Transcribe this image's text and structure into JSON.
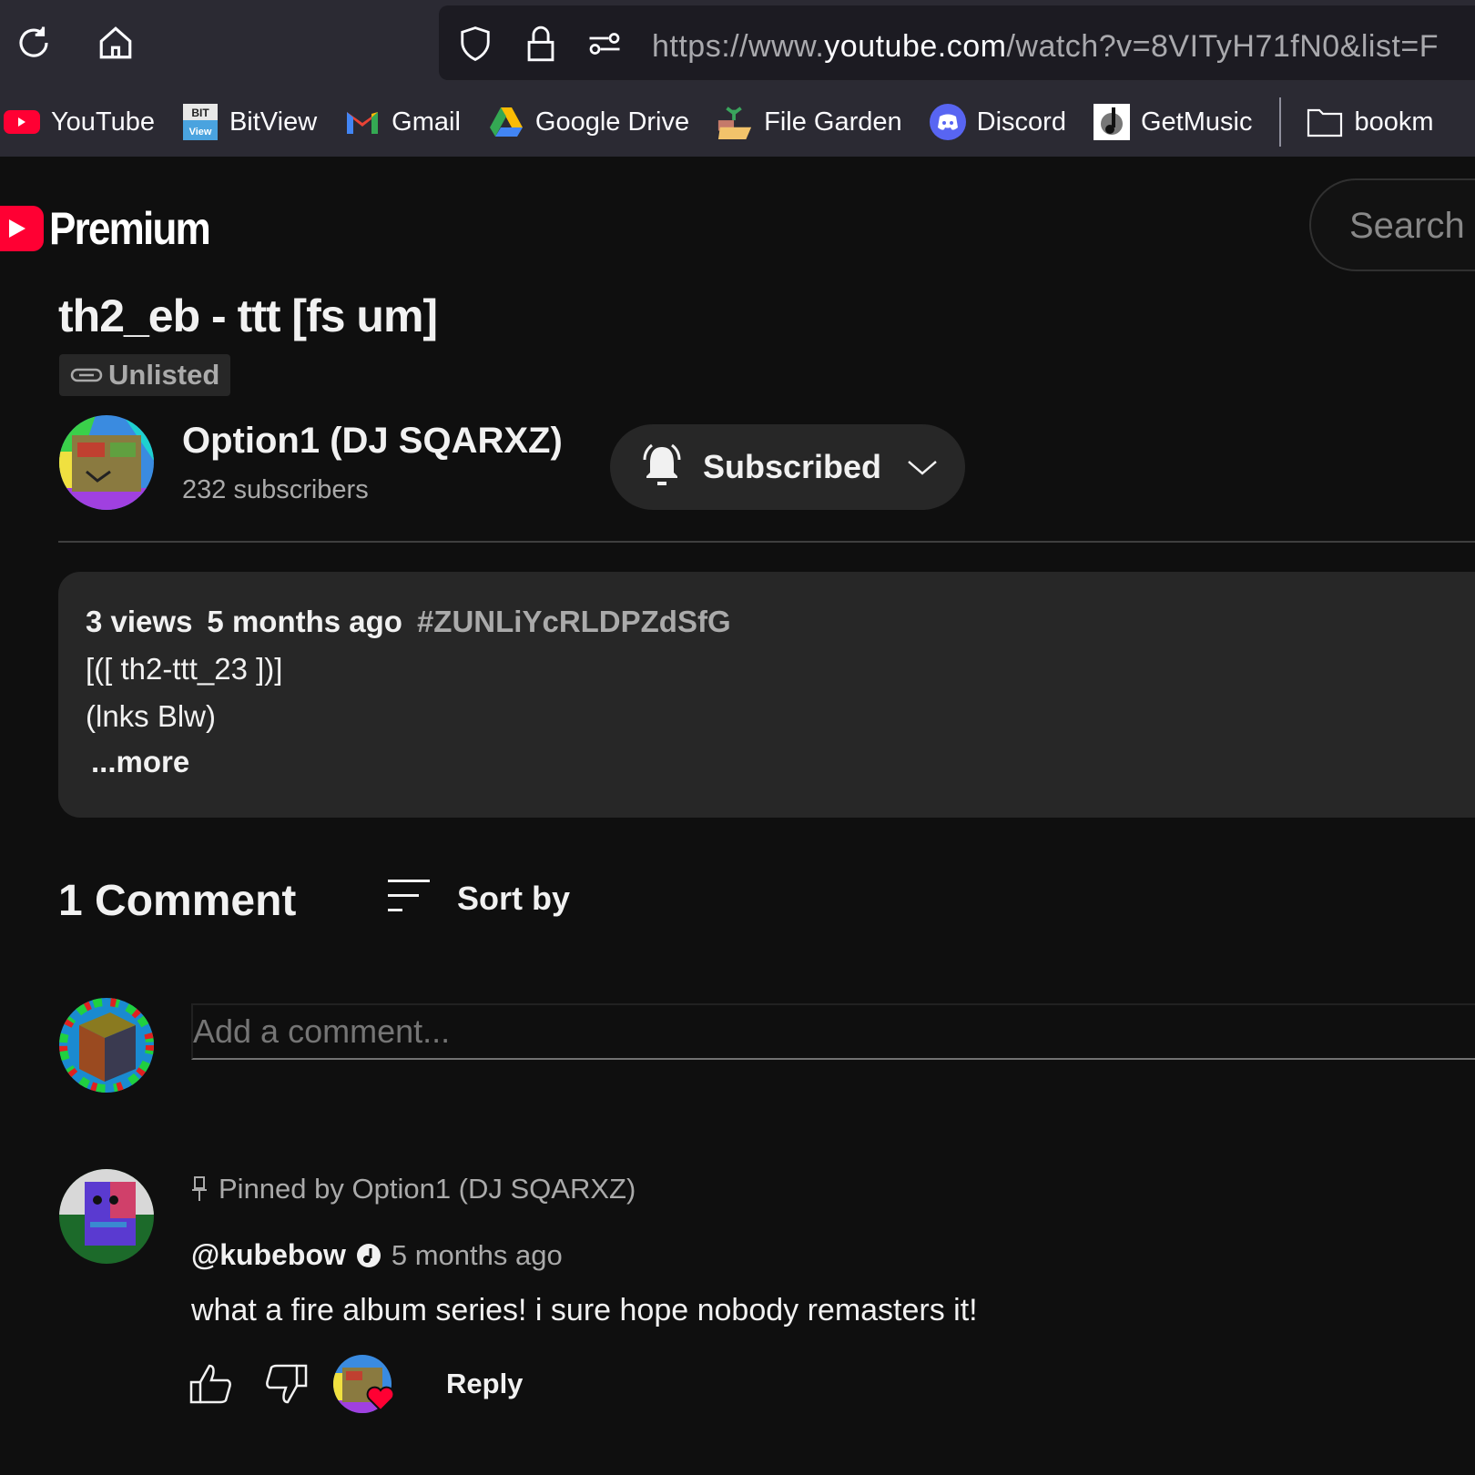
{
  "browser": {
    "url_prefix": "https://www.",
    "url_domain": "youtube.com",
    "url_rest": "/watch?v=8VITyH71fN0&list=F",
    "bookmarks": [
      {
        "label": "YouTube",
        "icon": "youtube-icon"
      },
      {
        "label": "BitView",
        "icon": "bitview-icon"
      },
      {
        "label": "Gmail",
        "icon": "gmail-icon"
      },
      {
        "label": "Google Drive",
        "icon": "google-drive-icon"
      },
      {
        "label": "File Garden",
        "icon": "file-garden-icon"
      },
      {
        "label": "Discord",
        "icon": "discord-icon"
      },
      {
        "label": "GetMusic",
        "icon": "getmusic-icon"
      },
      {
        "label": "bookm",
        "icon": "folder-icon"
      }
    ]
  },
  "youtube": {
    "logo_text": "Premium",
    "search_placeholder": "Search",
    "video": {
      "title": "th2_eb - ttt [fs um]",
      "visibility": "Unlisted",
      "channel_name": "Option1 (DJ SQARXZ)",
      "subscribers": "232 subscribers",
      "subscribe_label": "Subscribed",
      "views": "3 views",
      "published": "5 months ago",
      "hashtag": "#ZUNLiYcRLDPZdSfG",
      "description_lines": [
        "[([ th2-ttt_23 ])]",
        "(lnks Blw)"
      ],
      "more_label": "...more"
    },
    "comments": {
      "count_label": "1 Comment",
      "sort_label": "Sort by",
      "add_placeholder": "Add a comment...",
      "items": [
        {
          "pinned_label": "Pinned by Option1 (DJ SQARXZ)",
          "author": "@kubebow",
          "time": "5 months ago",
          "text": "what a fire album series! i sure hope nobody remasters it!",
          "reply_label": "Reply"
        }
      ]
    }
  },
  "colors": {
    "accent": "#ff0033",
    "background": "#0f0f0f",
    "chrome": "#2b2a33"
  }
}
